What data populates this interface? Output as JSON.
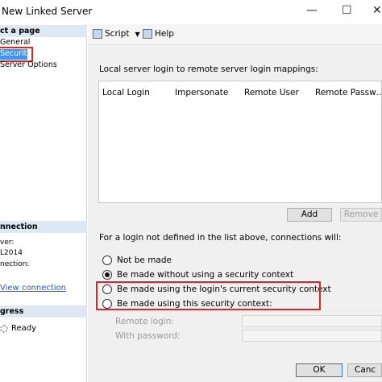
{
  "window": {
    "title": "New Linked Server",
    "minimize": "—",
    "maximize": "☐",
    "close": "✕"
  },
  "left_panel": {
    "select_page_header": "ct a page",
    "pages": [
      "General",
      "Security",
      "Server Options"
    ],
    "connection_header": "nnection",
    "server_label": "ver:",
    "server_value": "L2014",
    "connection_label": "nection:",
    "view_connection": "View connection",
    "progress_header": "gress",
    "progress_status": "Ready"
  },
  "toolbar": {
    "script_label": "Script",
    "help_label": "Help"
  },
  "mappings": {
    "caption": "Local server login to remote server login mappings:",
    "columns": [
      "Local Login",
      "Impersonate",
      "Remote User",
      "Remote Passw…"
    ],
    "add_label": "Add",
    "remove_label": "Remove"
  },
  "connections": {
    "caption": "For a login not defined in the list above, connections will:",
    "options": [
      {
        "label": "Not be made",
        "checked": false
      },
      {
        "label": "Be made without using a security context",
        "checked": true
      },
      {
        "label": "Be made using the login's current security context",
        "checked": false
      },
      {
        "label": "Be made using this security context:",
        "checked": false
      }
    ],
    "remote_login_label": "Remote login:",
    "password_label": "With password:"
  },
  "footer": {
    "ok_label": "OK",
    "cancel_label": "Canc"
  },
  "colors": {
    "highlight_red": "#d9262b",
    "selection_blue": "#3399ff",
    "section_header": "#dde8f4"
  }
}
